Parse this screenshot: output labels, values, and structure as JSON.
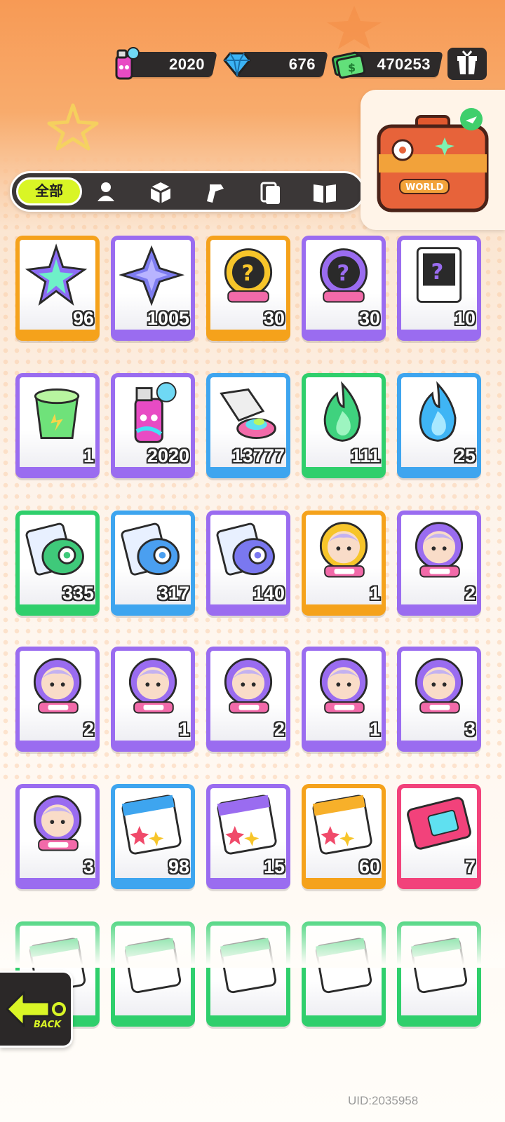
{
  "currency": {
    "spray": {
      "value": "2020",
      "icon": "spray-can-icon"
    },
    "diamond": {
      "value": "676",
      "icon": "diamond-icon"
    },
    "cash": {
      "value": "470253",
      "icon": "cash-icon"
    }
  },
  "tabs": {
    "all_label": "全部",
    "items": [
      "character-icon",
      "box-icon",
      "spray-gun-icon",
      "cards-icon",
      "book-icon"
    ]
  },
  "travel": {
    "label": "WORLD",
    "icon": "suitcase-icon"
  },
  "items": [
    {
      "count": "96",
      "rarity": "orange",
      "icon": "rainbow-star-icon"
    },
    {
      "count": "1005",
      "rarity": "purple",
      "icon": "blue-star-icon"
    },
    {
      "count": "30",
      "rarity": "orange",
      "icon": "mystery-deity-gold-icon"
    },
    {
      "count": "30",
      "rarity": "purple",
      "icon": "mystery-deity-purple-icon"
    },
    {
      "count": "10",
      "rarity": "purple",
      "icon": "mystery-travel-card-icon"
    },
    {
      "count": "1",
      "rarity": "purple",
      "icon": "energy-cup-icon"
    },
    {
      "count": "2020",
      "rarity": "purple",
      "icon": "spray-can-icon"
    },
    {
      "count": "13777",
      "rarity": "blue",
      "icon": "paint-tube-icon"
    },
    {
      "count": "111",
      "rarity": "green",
      "icon": "green-flame-icon"
    },
    {
      "count": "25",
      "rarity": "blue",
      "icon": "blue-flame-icon"
    },
    {
      "count": "335",
      "rarity": "green",
      "icon": "green-film-roll-icon"
    },
    {
      "count": "317",
      "rarity": "blue",
      "icon": "blue-film-roll-icon"
    },
    {
      "count": "140",
      "rarity": "purple",
      "icon": "purple-film-roll-icon"
    },
    {
      "count": "1",
      "rarity": "orange",
      "icon": "deity-portrait-icon"
    },
    {
      "count": "2",
      "rarity": "purple",
      "icon": "deity-portrait-icon"
    },
    {
      "count": "2",
      "rarity": "purple",
      "icon": "deity-portrait-icon"
    },
    {
      "count": "1",
      "rarity": "purple",
      "icon": "deity-portrait-icon"
    },
    {
      "count": "2",
      "rarity": "purple",
      "icon": "deity-portrait-icon"
    },
    {
      "count": "1",
      "rarity": "purple",
      "icon": "deity-portrait-icon"
    },
    {
      "count": "3",
      "rarity": "purple",
      "icon": "deity-portrait-icon"
    },
    {
      "count": "3",
      "rarity": "purple",
      "icon": "deity-portrait-icon"
    },
    {
      "count": "98",
      "rarity": "blue",
      "icon": "sticker-pack-icon"
    },
    {
      "count": "15",
      "rarity": "purple",
      "icon": "sticker-pack-icon"
    },
    {
      "count": "60",
      "rarity": "orange",
      "icon": "sticker-pack-icon"
    },
    {
      "count": "7",
      "rarity": "pink",
      "icon": "pink-ticket-icon"
    },
    {
      "count": "",
      "rarity": "green",
      "icon": "card-pack-icon"
    },
    {
      "count": "",
      "rarity": "green",
      "icon": "card-pack-icon"
    },
    {
      "count": "",
      "rarity": "green",
      "icon": "card-pack-icon"
    },
    {
      "count": "",
      "rarity": "green",
      "icon": "card-pack-icon"
    },
    {
      "count": "",
      "rarity": "green",
      "icon": "card-pack-icon"
    }
  ],
  "back_label": "BACK",
  "uid": "UID:2035958",
  "colors": {
    "orange": "#f5a21b",
    "purple": "#9a6cf0",
    "blue": "#3ea5ef",
    "green": "#2fcf6c",
    "pink": "#f2427b",
    "accent": "#d9f526"
  }
}
